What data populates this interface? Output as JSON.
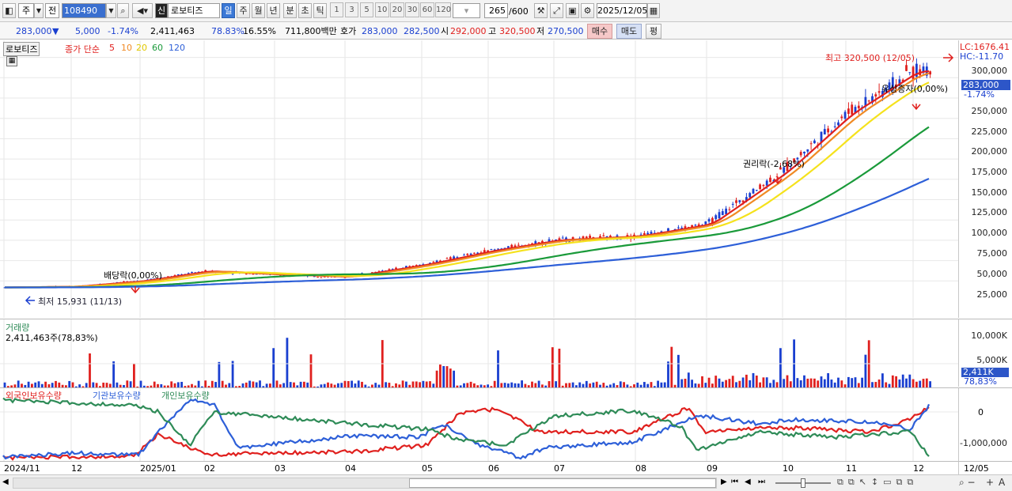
{
  "toolbar": {
    "code": "108490",
    "name": "로보티즈",
    "market_badge": "신",
    "period_tabs": [
      "일",
      "주",
      "월",
      "년",
      "분",
      "초",
      "틱"
    ],
    "period_selected": "일",
    "minute_steps": [
      "1",
      "3",
      "5",
      "10",
      "20",
      "30",
      "60",
      "120"
    ],
    "count": "265",
    "count_max": "/600",
    "date": "2025/12/05",
    "type_label": "주",
    "prev_label": "전"
  },
  "quote": {
    "price": "283,000",
    "change": "5,000",
    "change_pct": "-1.74%",
    "volume": "2,411,463",
    "vol_ratio": "78.83%",
    "turnover": "16.55%",
    "amount": "711,800백만",
    "ask_label": "호가",
    "ask": "283,000",
    "bid": "282,500",
    "open_label": "시",
    "open": "292,000",
    "high_label": "고",
    "high": "320,500",
    "low_label": "저",
    "low": "270,500",
    "buy": "매수",
    "sell": "매도",
    "avg": "평"
  },
  "price_pane": {
    "title": "로보티즈",
    "legend_label": "종가 단순",
    "ma": [
      {
        "period": "5",
        "color": "#e0201e"
      },
      {
        "period": "10",
        "color": "#f08a24"
      },
      {
        "period": "20",
        "color": "#f5e21c"
      },
      {
        "period": "60",
        "color": "#1a9a3a"
      },
      {
        "period": "120",
        "color": "#2d5fd8"
      }
    ],
    "lc": "LC:1676.41",
    "hc": "HC:-11.70",
    "last_price": "283,000",
    "last_pct": "-1.74%",
    "ticks": [
      "300,000",
      "275,000",
      "250,000",
      "225,000",
      "200,000",
      "175,000",
      "150,000",
      "125,000",
      "100,000",
      "75,000",
      "50,000",
      "25,000"
    ],
    "annotations": {
      "high": "최고 320,500 (12/05)",
      "low": "최저 15,931 (11/13)",
      "dividend": "배당락(0,00%)",
      "rights": "권리락(-2,68%)",
      "offering": "유상증자(0,00%)"
    }
  },
  "volume_pane": {
    "title": "거래량",
    "value": "2,411,463주(78,83%)",
    "ticks": [
      "10,000K",
      "5,000K"
    ],
    "last": "2,411K",
    "last_pct": "78,83%"
  },
  "holding_pane": {
    "series": [
      {
        "name": "외국인보유수량",
        "color": "#e0201e"
      },
      {
        "name": "기관보유수량",
        "color": "#2d5fd8"
      },
      {
        "name": "개인보유수량",
        "color": "#2e8b57"
      }
    ],
    "ticks": [
      "0",
      "-1,000,000"
    ]
  },
  "x_axis": {
    "labels": [
      "2024/11",
      "12",
      "2025/01",
      "02",
      "03",
      "04",
      "05",
      "06",
      "07",
      "08",
      "09",
      "10",
      "11",
      "12"
    ],
    "last_date": "12/05"
  },
  "chart_data": {
    "type": "line",
    "title": "로보티즈",
    "x": [
      "2024/11",
      "12",
      "2025/01",
      "02",
      "03",
      "04",
      "05",
      "06",
      "07",
      "08",
      "09",
      "10",
      "11",
      "12"
    ],
    "series": [
      {
        "name": "종가",
        "values": [
          17000,
          18000,
          25000,
          37000,
          33000,
          30000,
          45000,
          62000,
          75000,
          80000,
          95000,
          160000,
          230000,
          283000
        ]
      }
    ],
    "ylim": [
      0,
      320500
    ]
  }
}
